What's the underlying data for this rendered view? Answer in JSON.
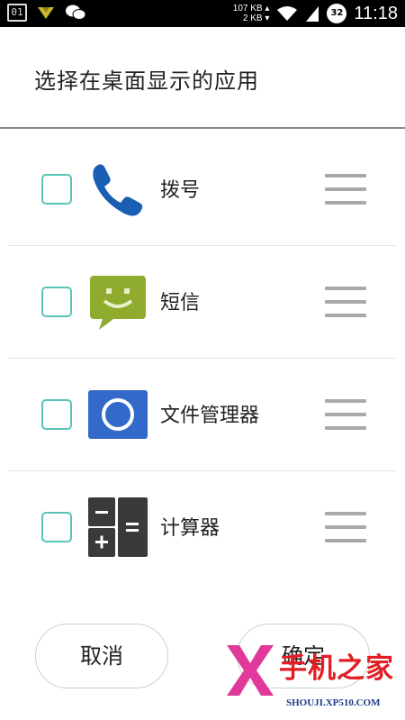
{
  "status_bar": {
    "calendar_day": "01",
    "net_up": "107 KB",
    "net_down": "2 KB",
    "battery_level": "32",
    "time": "11:18",
    "icons": [
      "calendar-icon",
      "download-icon",
      "wechat-icon",
      "wifi-icon",
      "signal-icon",
      "battery-icon"
    ]
  },
  "dialog": {
    "title": "选择在桌面显示的应用",
    "apps": [
      {
        "label": "拨号",
        "icon": "phone-icon",
        "checked": false
      },
      {
        "label": "短信",
        "icon": "sms-icon",
        "checked": false
      },
      {
        "label": "文件管理器",
        "icon": "file-manager-icon",
        "checked": false
      },
      {
        "label": "计算器",
        "icon": "calculator-icon",
        "checked": false
      }
    ],
    "cancel_label": "取消",
    "confirm_label": "确定"
  },
  "watermark": {
    "logo_text": "XP",
    "brand_text": "手机之家",
    "url_text": "SHOUJI.XP510.COM"
  },
  "colors": {
    "accent": "#58c4b7",
    "phone_blue": "#1a5fb4",
    "sms_green": "#8fac2f",
    "file_blue": "#3369c9",
    "watermark_red": "#e41e24"
  }
}
